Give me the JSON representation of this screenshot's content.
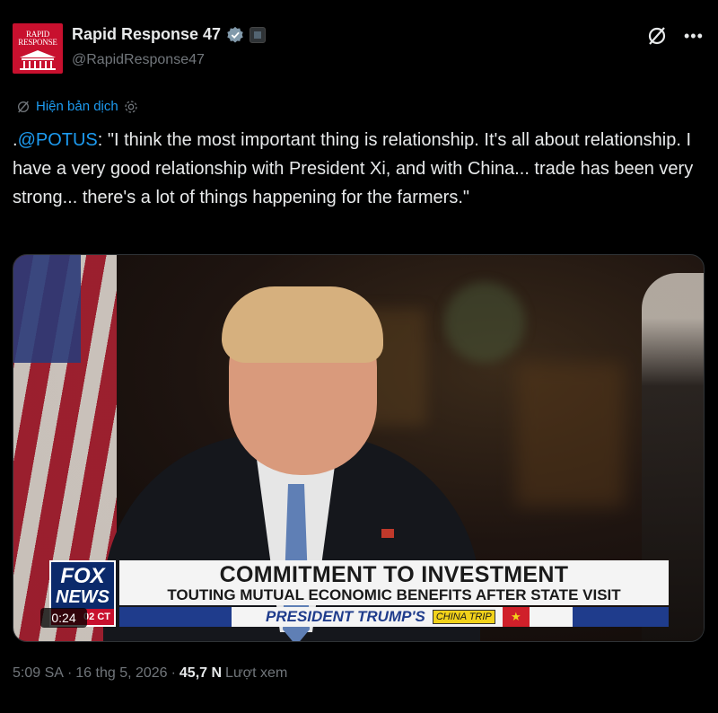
{
  "author": {
    "avatar_line1": "RAPID",
    "avatar_line2": "RESPONSE",
    "name": "Rapid Response 47",
    "handle": "@RapidResponse47"
  },
  "translate": {
    "label": "Hiện bản dịch"
  },
  "tweet": {
    "prefix": ".",
    "mention": "@POTUS",
    "body": ": \"I think the most important thing is relationship. It's all about relationship. I have a very good relationship with President Xi, and with China... trade has been very strong... there's a lot of things happening for the farmers.\""
  },
  "video": {
    "duration": "0:24",
    "fox_line1": "FOX",
    "fox_line2": "NEWS",
    "fox_time": "02 CT",
    "headline": "COMMITMENT TO INVESTMENT",
    "subheadline": "TOUTING MUTUAL ECONOMIC BENEFITS AFTER STATE VISIT",
    "ticker": "PRESIDENT TRUMP'S",
    "ticker_tag": "CHINA TRIP",
    "ticker_star": "★"
  },
  "meta": {
    "time": "5:09 SA",
    "sep1": "·",
    "date": "16 thg 5, 2026",
    "sep2": "·",
    "views_count": "45,7 N",
    "views_label": "Lượt xem"
  },
  "icons": {
    "verified": "verified-badge-icon",
    "affiliation": "affiliate-icon",
    "grok": "grok-icon",
    "more": "more-icon",
    "translate": "translate-icon",
    "settings": "gear-icon"
  },
  "colors": {
    "link": "#1d9bf0",
    "text": "#e7e9ea",
    "muted": "#71767b",
    "background": "#000000"
  }
}
